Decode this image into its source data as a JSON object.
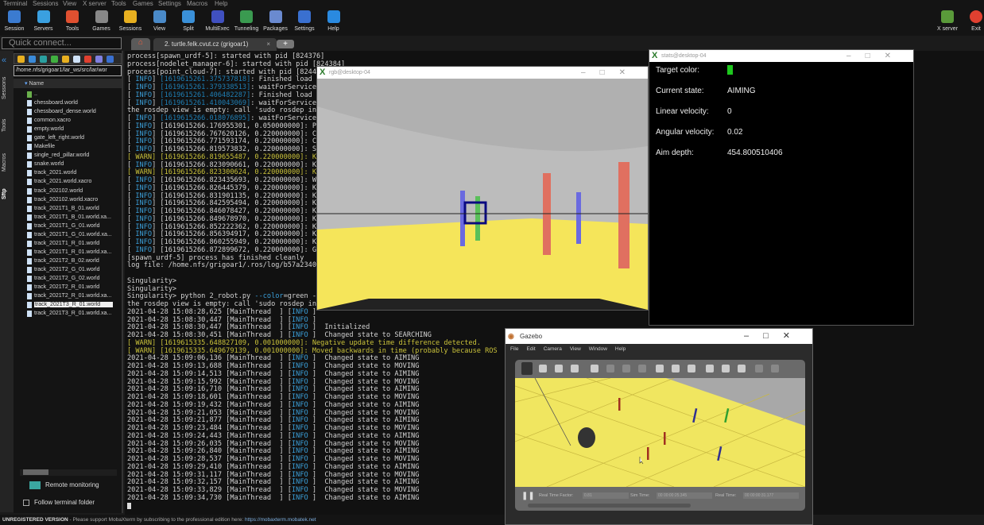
{
  "menu": [
    "Terminal",
    "Sessions",
    "View",
    "X server",
    "Tools",
    "Games",
    "Settings",
    "Macros",
    "Help"
  ],
  "toolbar": [
    {
      "label": "Session",
      "icon": "session-icon",
      "color": "#3b7bd0"
    },
    {
      "label": "Servers",
      "icon": "servers-icon",
      "color": "#3aa0e0"
    },
    {
      "label": "Tools",
      "icon": "tools-icon",
      "color": "#e05030"
    },
    {
      "label": "Games",
      "icon": "games-icon",
      "color": "#888"
    },
    {
      "label": "Sessions",
      "icon": "star-icon",
      "color": "#e8b020"
    },
    {
      "label": "View",
      "icon": "view-icon",
      "color": "#4a8ac8"
    },
    {
      "label": "Split",
      "icon": "split-icon",
      "color": "#3a90d8"
    },
    {
      "label": "MultiExec",
      "icon": "multiexec-icon",
      "color": "#4050c0"
    },
    {
      "label": "Tunneling",
      "icon": "tunneling-icon",
      "color": "#3a9a50"
    },
    {
      "label": "Packages",
      "icon": "packages-icon",
      "color": "#6a8ad0"
    },
    {
      "label": "Settings",
      "icon": "gear-icon",
      "color": "#3a70d0"
    },
    {
      "label": "Help",
      "icon": "help-icon",
      "color": "#2a8ae0"
    }
  ],
  "toolbar_right": [
    {
      "label": "X server",
      "icon": "xserver-icon"
    },
    {
      "label": "Exit",
      "icon": "power-icon"
    }
  ],
  "quick_connect_placeholder": "Quick connect...",
  "tabs": {
    "active": "2. turtle.felk.cvut.cz (grigoar1)",
    "close": "×",
    "add": "+"
  },
  "vertical_tabs": [
    "Sessions",
    "Tools",
    "Macros",
    "Sftp"
  ],
  "sftp": {
    "path": "/home.nfs/grigoar1/lar_ws/src/lar/wor",
    "column": "Name",
    "files": [
      "..",
      "chessboard.world",
      "chessboard_dense.world",
      "common.xacro",
      "empty.world",
      "gate_left_right.world",
      "Makefile",
      "single_red_pillar.world",
      "snake.world",
      "track_2021.world",
      "track_2021.world.xacro",
      "track_202102.world",
      "track_202102.world.xacro",
      "track_2021T1_B_01.world",
      "track_2021T1_B_01.world.xa...",
      "track_2021T1_G_01.world",
      "track_2021T1_G_01.world.xa...",
      "track_2021T1_R_01.world",
      "track_2021T1_R_01.world.xa...",
      "track_2021T2_B_02.world",
      "track_2021T2_G_01.world",
      "track_2021T2_G_02.world",
      "track_2021T2_R_01.world",
      "track_2021T2_R_01.world.xa...",
      "track_2021T3_R_01.world",
      "track_2021T3_R_01.world.xa..."
    ],
    "selected": "track_2021T3_R_01.world",
    "remote_monitoring": "Remote monitoring",
    "follow_terminal_folder": "Follow terminal folder",
    "follow_checked": false
  },
  "terminal": [
    [
      [
        "w",
        "process[spawn_urdf-5]: started with pid [824376]"
      ]
    ],
    [
      [
        "w",
        "process[nodelet_manager-6]: started with pid [824384]"
      ]
    ],
    [
      [
        "w",
        "process[point_cloud-7]: started with pid [8244"
      ]
    ],
    [
      [
        "w",
        "[ "
      ],
      [
        "b",
        "INFO"
      ],
      [
        "w",
        "] "
      ],
      [
        "bt",
        "[1619615261.375737818]"
      ],
      [
        "w",
        ": Finished load"
      ]
    ],
    [
      [
        "w",
        "[ "
      ],
      [
        "b",
        "INFO"
      ],
      [
        "w",
        "] "
      ],
      [
        "bt",
        "[1619615261.379338513]"
      ],
      [
        "w",
        ": waitForService"
      ]
    ],
    [
      [
        "w",
        "[ "
      ],
      [
        "b",
        "INFO"
      ],
      [
        "w",
        "] "
      ],
      [
        "bt",
        "[1619615261.406482287]"
      ],
      [
        "w",
        ": Finished load"
      ]
    ],
    [
      [
        "w",
        "[ "
      ],
      [
        "b",
        "INFO"
      ],
      [
        "w",
        "] "
      ],
      [
        "bt",
        "[1619615261.410043069]"
      ],
      [
        "w",
        ": waitForService"
      ]
    ],
    [
      [
        "w",
        "the rosdep view is empty: call 'sudo rosdep in"
      ]
    ],
    [
      [
        "w",
        "[ "
      ],
      [
        "b",
        "INFO"
      ],
      [
        "w",
        "] "
      ],
      [
        "bt",
        "[1619615266.018076895]"
      ],
      [
        "w",
        ": waitForService"
      ]
    ],
    [
      [
        "w",
        "[ "
      ],
      [
        "b",
        "INFO"
      ],
      [
        "w",
        "] [1619615266.176955301, 0.050000000]: P"
      ]
    ],
    [
      [
        "w",
        "[ "
      ],
      [
        "b",
        "INFO"
      ],
      [
        "w",
        "] [1619615266.767620126, 0.220000000]: C"
      ]
    ],
    [
      [
        "w",
        "[ "
      ],
      [
        "b",
        "INFO"
      ],
      [
        "w",
        "] [1619615266.771593174, 0.220000000]: C"
      ]
    ],
    [
      [
        "w",
        "[ "
      ],
      [
        "b",
        "INFO"
      ],
      [
        "w",
        "] [1619615266.819573832, 0.220000000]: S"
      ]
    ],
    [
      [
        "y",
        "[ WARN] [1619615266.819655487, 0.220000000]: K"
      ]
    ],
    [
      [
        "w",
        "[ "
      ],
      [
        "b",
        "INFO"
      ],
      [
        "w",
        "] [1619615266.823090661, 0.220000000]: K"
      ]
    ],
    [
      [
        "y",
        "[ WARN] [1619615266.823300624, 0.220000000]: K"
      ]
    ],
    [
      [
        "w",
        "[ "
      ],
      [
        "b",
        "INFO"
      ],
      [
        "w",
        "] [1619615266.823435693, 0.220000000]: W"
      ]
    ],
    [
      [
        "w",
        "[ "
      ],
      [
        "b",
        "INFO"
      ],
      [
        "w",
        "] [1619615266.826445379, 0.220000000]: K"
      ]
    ],
    [
      [
        "w",
        "[ "
      ],
      [
        "b",
        "INFO"
      ],
      [
        "w",
        "] [1619615266.831901135, 0.220000000]: K"
      ]
    ],
    [
      [
        "w",
        "[ "
      ],
      [
        "b",
        "INFO"
      ],
      [
        "w",
        "] [1619615266.842595494, 0.220000000]: K"
      ]
    ],
    [
      [
        "w",
        "[ "
      ],
      [
        "b",
        "INFO"
      ],
      [
        "w",
        "] [1619615266.846078427, 0.220000000]: K"
      ]
    ],
    [
      [
        "w",
        "[ "
      ],
      [
        "b",
        "INFO"
      ],
      [
        "w",
        "] [1619615266.849678970, 0.220000000]: K"
      ]
    ],
    [
      [
        "w",
        "[ "
      ],
      [
        "b",
        "INFO"
      ],
      [
        "w",
        "] [1619615266.852222362, 0.220000000]: K"
      ]
    ],
    [
      [
        "w",
        "[ "
      ],
      [
        "b",
        "INFO"
      ],
      [
        "w",
        "] [1619615266.856394917, 0.220000000]: K"
      ]
    ],
    [
      [
        "w",
        "[ "
      ],
      [
        "b",
        "INFO"
      ],
      [
        "w",
        "] [1619615266.860255949, 0.220000000]: K"
      ]
    ],
    [
      [
        "w",
        "[ "
      ],
      [
        "b",
        "INFO"
      ],
      [
        "w",
        "] [1619615266.872899672, 0.220000000]: G"
      ]
    ],
    [
      [
        "w",
        "[spawn_urdf-5] process has finished cleanly"
      ]
    ],
    [
      [
        "w",
        "log file: /home.nfs/grigoar1/.ros/log/b57a2340"
      ]
    ],
    [
      [
        "w",
        " "
      ]
    ],
    [
      [
        "w",
        "Singularity>"
      ]
    ],
    [
      [
        "w",
        "Singularity>"
      ]
    ],
    [
      [
        "w",
        "Singularity> python 2_robot.py "
      ],
      [
        "b",
        "--color"
      ],
      [
        "w",
        "=green -"
      ]
    ],
    [
      [
        "w",
        "the rosdep view is empty: call 'sudo rosdep in"
      ]
    ],
    [
      [
        "w",
        "2021-04-28 15:08:28,625 [MainThread  ] ["
      ],
      [
        "b",
        "INFO"
      ],
      [
        "w",
        " ]"
      ]
    ],
    [
      [
        "w",
        "2021-04-28 15:08:30,447 [MainThread  ] ["
      ],
      [
        "b",
        "INFO"
      ],
      [
        "w",
        " ]"
      ]
    ],
    [
      [
        "w",
        "2021-04-28 15:08:30,447 [MainThread  ] ["
      ],
      [
        "b",
        "INFO"
      ],
      [
        "w",
        " ]  Initialized"
      ]
    ],
    [
      [
        "w",
        "2021-04-28 15:08:30,451 [MainThread  ] ["
      ],
      [
        "b",
        "INFO"
      ],
      [
        "w",
        " ]  Changed state to SEARCHING"
      ]
    ],
    [
      [
        "y",
        "[ WARN] [1619615335.648827109, 0.001000000]: Negative update time difference detected."
      ]
    ],
    [
      [
        "y",
        "[ WARN] [1619615335.649679139, 0.001000000]: Moved backwards in time (probably because ROS"
      ]
    ],
    [
      [
        "w",
        "2021-04-28 15:09:06,136 [MainThread  ] ["
      ],
      [
        "b",
        "INFO"
      ],
      [
        "w",
        " ]  Changed state to AIMING"
      ]
    ],
    [
      [
        "w",
        "2021-04-28 15:09:13,688 [MainThread  ] ["
      ],
      [
        "b",
        "INFO"
      ],
      [
        "w",
        " ]  Changed state to MOVING"
      ]
    ],
    [
      [
        "w",
        "2021-04-28 15:09:14,513 [MainThread  ] ["
      ],
      [
        "b",
        "INFO"
      ],
      [
        "w",
        " ]  Changed state to AIMING"
      ]
    ],
    [
      [
        "w",
        "2021-04-28 15:09:15,992 [MainThread  ] ["
      ],
      [
        "b",
        "INFO"
      ],
      [
        "w",
        " ]  Changed state to MOVING"
      ]
    ],
    [
      [
        "w",
        "2021-04-28 15:09:16,710 [MainThread  ] ["
      ],
      [
        "b",
        "INFO"
      ],
      [
        "w",
        " ]  Changed state to AIMING"
      ]
    ],
    [
      [
        "w",
        "2021-04-28 15:09:18,601 [MainThread  ] ["
      ],
      [
        "b",
        "INFO"
      ],
      [
        "w",
        " ]  Changed state to MOVING"
      ]
    ],
    [
      [
        "w",
        "2021-04-28 15:09:19,432 [MainThread  ] ["
      ],
      [
        "b",
        "INFO"
      ],
      [
        "w",
        " ]  Changed state to AIMING"
      ]
    ],
    [
      [
        "w",
        "2021-04-28 15:09:21,053 [MainThread  ] ["
      ],
      [
        "b",
        "INFO"
      ],
      [
        "w",
        " ]  Changed state to MOVING"
      ]
    ],
    [
      [
        "w",
        "2021-04-28 15:09:21,877 [MainThread  ] ["
      ],
      [
        "b",
        "INFO"
      ],
      [
        "w",
        " ]  Changed state to AIMING"
      ]
    ],
    [
      [
        "w",
        "2021-04-28 15:09:23,484 [MainThread  ] ["
      ],
      [
        "b",
        "INFO"
      ],
      [
        "w",
        " ]  Changed state to MOVING"
      ]
    ],
    [
      [
        "w",
        "2021-04-28 15:09:24,443 [MainThread  ] ["
      ],
      [
        "b",
        "INFO"
      ],
      [
        "w",
        " ]  Changed state to AIMING"
      ]
    ],
    [
      [
        "w",
        "2021-04-28 15:09:26,035 [MainThread  ] ["
      ],
      [
        "b",
        "INFO"
      ],
      [
        "w",
        " ]  Changed state to MOVING"
      ]
    ],
    [
      [
        "w",
        "2021-04-28 15:09:26,840 [MainThread  ] ["
      ],
      [
        "b",
        "INFO"
      ],
      [
        "w",
        " ]  Changed state to AIMING"
      ]
    ],
    [
      [
        "w",
        "2021-04-28 15:09:28,537 [MainThread  ] ["
      ],
      [
        "b",
        "INFO"
      ],
      [
        "w",
        " ]  Changed state to MOVING"
      ]
    ],
    [
      [
        "w",
        "2021-04-28 15:09:29,410 [MainThread  ] ["
      ],
      [
        "b",
        "INFO"
      ],
      [
        "w",
        " ]  Changed state to AIMING"
      ]
    ],
    [
      [
        "w",
        "2021-04-28 15:09:31,117 [MainThread  ] ["
      ],
      [
        "b",
        "INFO"
      ],
      [
        "w",
        " ]  Changed state to MOVING"
      ]
    ],
    [
      [
        "w",
        "2021-04-28 15:09:32,157 [MainThread  ] ["
      ],
      [
        "b",
        "INFO"
      ],
      [
        "w",
        " ]  Changed state to AIMING"
      ]
    ],
    [
      [
        "w",
        "2021-04-28 15:09:33,829 [MainThread  ] ["
      ],
      [
        "b",
        "INFO"
      ],
      [
        "w",
        " ]  Changed state to MOVING"
      ]
    ],
    [
      [
        "w",
        "2021-04-28 15:09:34,730 [MainThread  ] ["
      ],
      [
        "b",
        "INFO"
      ],
      [
        "w",
        " ]  Changed state to AIMING"
      ]
    ]
  ],
  "rgb_window": {
    "title": "rgb@desktop-04"
  },
  "stats_window": {
    "title": "stats@desktop-04",
    "rows": [
      {
        "label": "Target color:",
        "value": "",
        "swatch": "#1ec81e"
      },
      {
        "label": "Current state:",
        "value": "AIMING"
      },
      {
        "label": "Linear velocity:",
        "value": "0"
      },
      {
        "label": "Angular velocity:",
        "value": "0.02"
      },
      {
        "label": "Aim depth:",
        "value": "454.800510406"
      }
    ]
  },
  "gazebo": {
    "title": "Gazebo",
    "menu": [
      "File",
      "Edit",
      "Camera",
      "View",
      "Window",
      "Help"
    ],
    "bottom": {
      "rtf_label": "Real Time Factor:",
      "rtf": "0.81",
      "sim_label": "Sim Time:",
      "sim": "00 00:00:25.345",
      "real_label": "Real Time:",
      "real": "00 00:00:31.177"
    }
  },
  "status": {
    "unregistered": "UNREGISTERED VERSION",
    "message": "-  Please support MobaXterm by subscribing to the professional edition here:",
    "link": "https://mobaxterm.mobatek.net"
  }
}
